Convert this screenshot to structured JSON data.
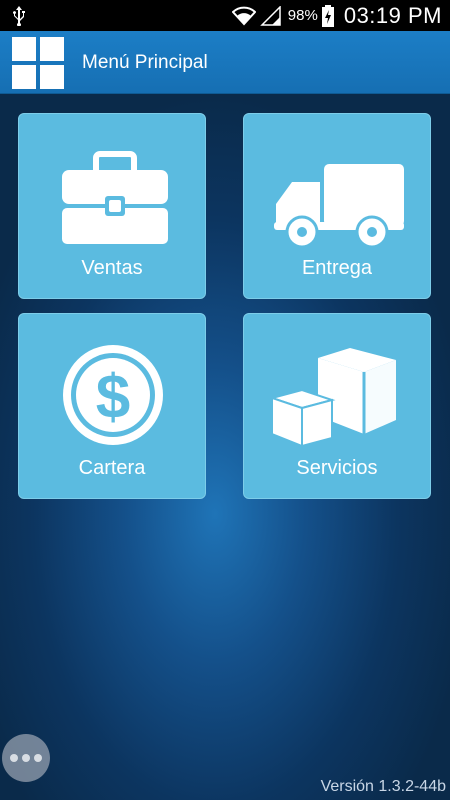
{
  "status_bar": {
    "battery_percent": "98%",
    "time": "03:19 PM",
    "icons": [
      "usb-icon",
      "wifi-icon",
      "signal-icon",
      "battery-charging-icon"
    ]
  },
  "action_bar": {
    "title": "Menú Principal",
    "logo_icon": "grid-icon"
  },
  "menu": {
    "tiles": [
      {
        "label": "Ventas",
        "icon": "briefcase-icon"
      },
      {
        "label": "Entrega",
        "icon": "truck-icon"
      },
      {
        "label": "Cartera",
        "icon": "dollar-coin-icon"
      },
      {
        "label": "Servicios",
        "icon": "boxes-icon"
      }
    ]
  },
  "overflow_icon": "more-dots-icon",
  "version": "Versión 1.3.2-44b",
  "colors": {
    "status_bar": "#000000",
    "action_bar": "#1a78c2",
    "tile": "#5bbbe0",
    "background": "#0c3560"
  }
}
